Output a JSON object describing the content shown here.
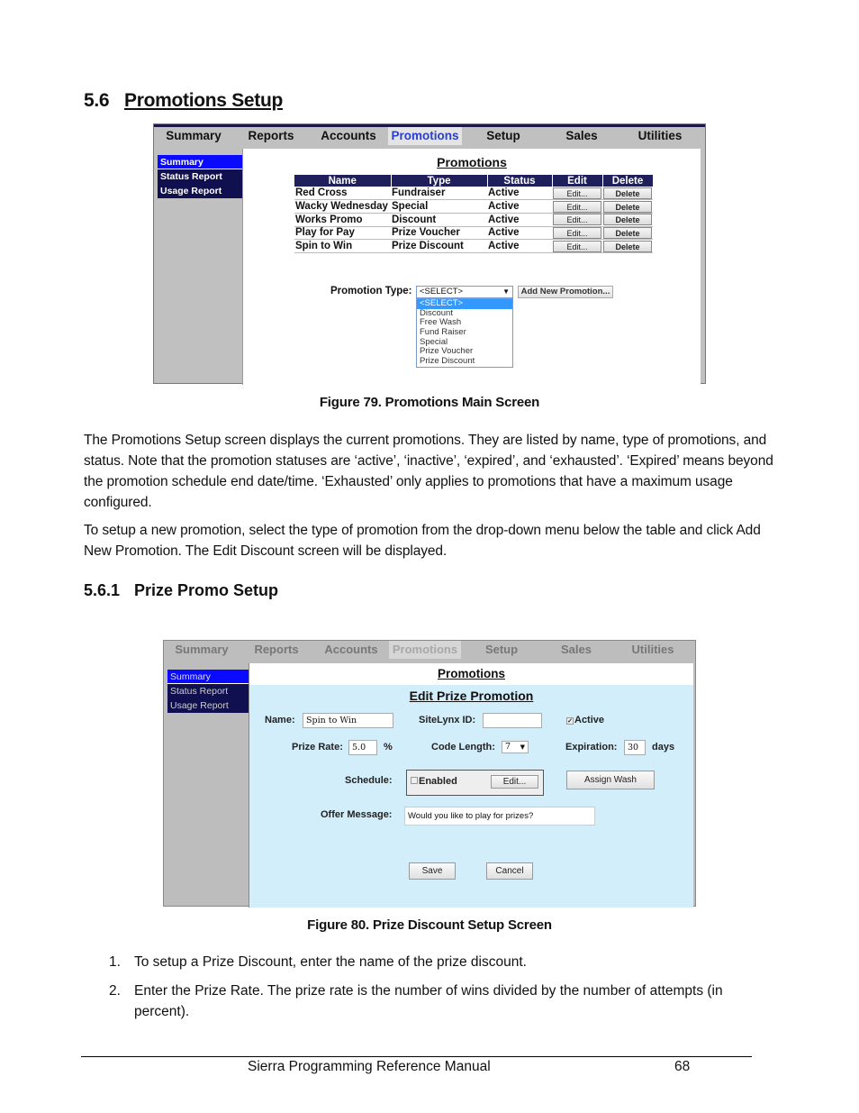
{
  "section": {
    "number": "5.6",
    "title": "Promotions Setup"
  },
  "figure79": {
    "caption": "Figure 79. Promotions Main Screen",
    "nav_tabs": [
      "Summary",
      "Reports",
      "Accounts",
      "Promotions",
      "Setup",
      "Sales",
      "Utilities"
    ],
    "active_tab": "Promotions",
    "left_nav": [
      "Summary",
      "Status Report",
      "Usage Report"
    ],
    "title": "Promotions",
    "table": {
      "headers": [
        "Name",
        "Type",
        "Status",
        "Edit",
        "Delete"
      ],
      "rows": [
        {
          "name": "Red Cross",
          "type": "Fundraiser",
          "status": "Active",
          "edit": "Edit...",
          "delete": "Delete"
        },
        {
          "name": "Wacky Wednesday",
          "type": "Special",
          "status": "Active",
          "edit": "Edit...",
          "delete": "Delete"
        },
        {
          "name": "Works Promo",
          "type": "Discount",
          "status": "Active",
          "edit": "Edit...",
          "delete": "Delete"
        },
        {
          "name": "Play for Pay",
          "type": "Prize Voucher",
          "status": "Active",
          "edit": "Edit...",
          "delete": "Delete"
        },
        {
          "name": "Spin to Win",
          "type": "Prize Discount",
          "status": "Active",
          "edit": "Edit...",
          "delete": "Delete"
        }
      ]
    },
    "promotion_type_label": "Promotion Type:",
    "promotion_type_value": "<SELECT>",
    "promotion_type_options": [
      "<SELECT>",
      "Discount",
      "Free Wash",
      "Fund Raiser",
      "Special",
      "Prize Voucher",
      "Prize Discount"
    ],
    "add_button": "Add New Promotion..."
  },
  "body_paragraphs": [
    "The Promotions Setup screen displays the current promotions. They are listed by name, type of promotions, and status. Note that the promotion statuses are ‘active’, ‘inactive’, ‘expired’, and ‘exhausted’. ‘Expired’ means beyond the promotion schedule end date/time. ‘Exhausted’ only applies to promotions that have a maximum usage configured.",
    "To setup a new promotion, select the type of promotion from the drop-down menu below the table and click Add New Promotion. The Edit Discount screen will be displayed."
  ],
  "subsection": {
    "number": "5.6.1",
    "title": "Prize Promo Setup"
  },
  "figure80": {
    "caption": "Figure 80. Prize Discount Setup Screen",
    "nav_tabs": [
      "Summary",
      "Reports",
      "Accounts",
      "Promotions",
      "Setup",
      "Sales",
      "Utilities"
    ],
    "left_nav": [
      "Summary",
      "Status Report",
      "Usage Report"
    ],
    "header": "Promotions",
    "title": "Edit Prize Promotion",
    "name_label": "Name:",
    "name_value": "Spin to Win",
    "sitelynx_label": "SiteLynx ID:",
    "sitelynx_value": "",
    "active_label": "Active",
    "active_checked": true,
    "prize_rate_label": "Prize Rate:",
    "prize_rate_value": "5.0",
    "prize_rate_unit": "%",
    "code_length_label": "Code Length:",
    "code_length_value": "7",
    "expiration_label": "Expiration:",
    "expiration_value": "30",
    "expiration_unit": "days",
    "schedule_label": "Schedule:",
    "schedule_enabled_label": "Enabled",
    "schedule_edit": "Edit...",
    "assign_wash": "Assign Wash",
    "offer_label": "Offer Message:",
    "offer_value": "Would you like to play for prizes?",
    "save": "Save",
    "cancel": "Cancel"
  },
  "steps": [
    {
      "n": "1.",
      "text": "To setup a Prize Discount, enter the name of the prize discount."
    },
    {
      "n": "2.",
      "text": "Enter the Prize Rate. The prize rate is the number of wins divided by the number of attempts (in percent)."
    }
  ],
  "footer": {
    "title": "Sierra Programming Reference Manual",
    "page": "68"
  }
}
